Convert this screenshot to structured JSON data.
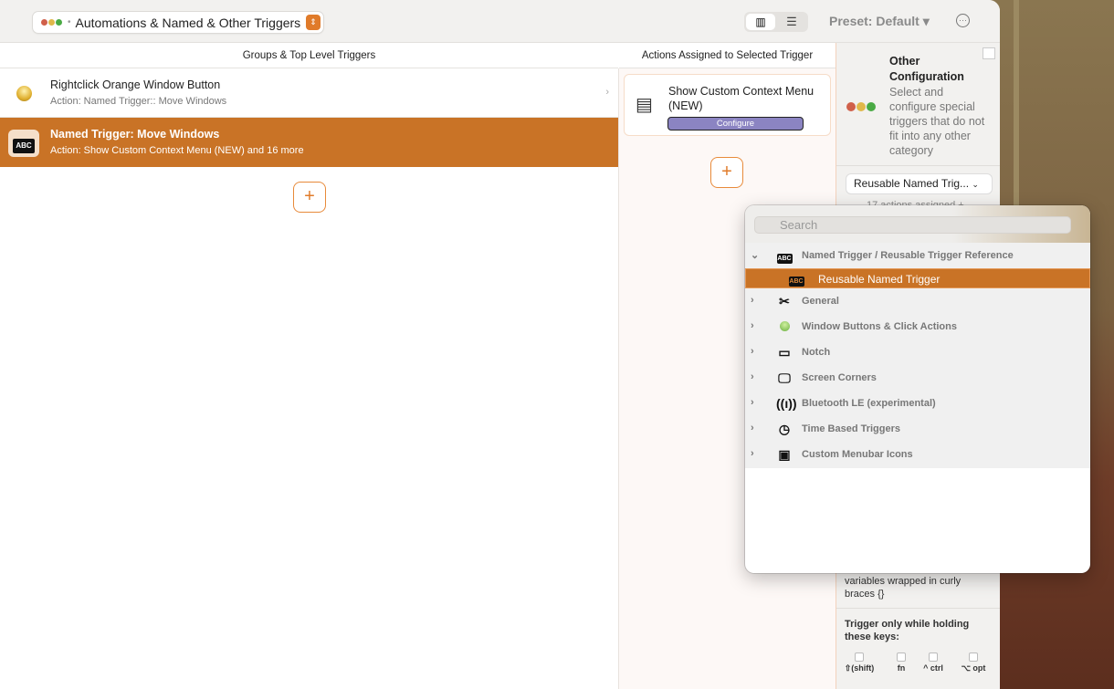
{
  "toolbar": {
    "group_title": "Automations & Named & Other Triggers",
    "preset": "Preset: Default ▾",
    "view_columns_icon": "columns-icon",
    "view_list_icon": "list-icon"
  },
  "columns": {
    "left_header": "Groups & Top Level Triggers",
    "mid_header": "Actions Assigned to Selected Trigger"
  },
  "triggers": [
    {
      "title": "Rightclick Orange Window Button",
      "subtitle": "Action: Named Trigger:: Move Windows",
      "icon": "orange-button-icon"
    },
    {
      "title": "Named Trigger: Move Windows",
      "subtitle": "Action: Show Custom Context Menu (NEW) and 16 more",
      "icon": "abc-icon",
      "selected": true
    }
  ],
  "action": {
    "title": "Show Custom Context Menu (NEW)",
    "configure": "Configure"
  },
  "plus": "+",
  "config": {
    "title": "Other Configuration",
    "description": "Select and configure special triggers that do not  fit into any other category",
    "dropdown": "Reusable Named Trig...",
    "assigned": "17 actions assigned +",
    "variables_text": "variables wrapped in curly braces {}",
    "keys_title": "Trigger only while holding these keys:",
    "keys": [
      "⇧(shift)",
      "fn",
      "^ ctrl",
      "⌥ opt"
    ]
  },
  "popover": {
    "search_placeholder": "Search",
    "items": [
      {
        "label": "Named Trigger / Reusable Trigger Reference",
        "expanded": true,
        "icon": "abc-icon"
      },
      {
        "label": "Reusable Named Trigger",
        "selected": true,
        "icon": "abc-icon"
      },
      {
        "label": "General",
        "icon": "tools-icon"
      },
      {
        "label": "Window Buttons & Click Actions",
        "icon": "green-button-icon"
      },
      {
        "label": "Notch",
        "icon": "notch-icon"
      },
      {
        "label": "Screen Corners",
        "icon": "monitor-icon"
      },
      {
        "label": "Bluetooth LE (experimental)",
        "icon": "antenna-icon"
      },
      {
        "label": "Time Based Triggers",
        "icon": "clock-icon"
      },
      {
        "label": "Custom Menubar Icons",
        "icon": "menubar-icon"
      }
    ]
  },
  "colors": {
    "accent": "#c97326",
    "configure": "#8b84c2"
  }
}
